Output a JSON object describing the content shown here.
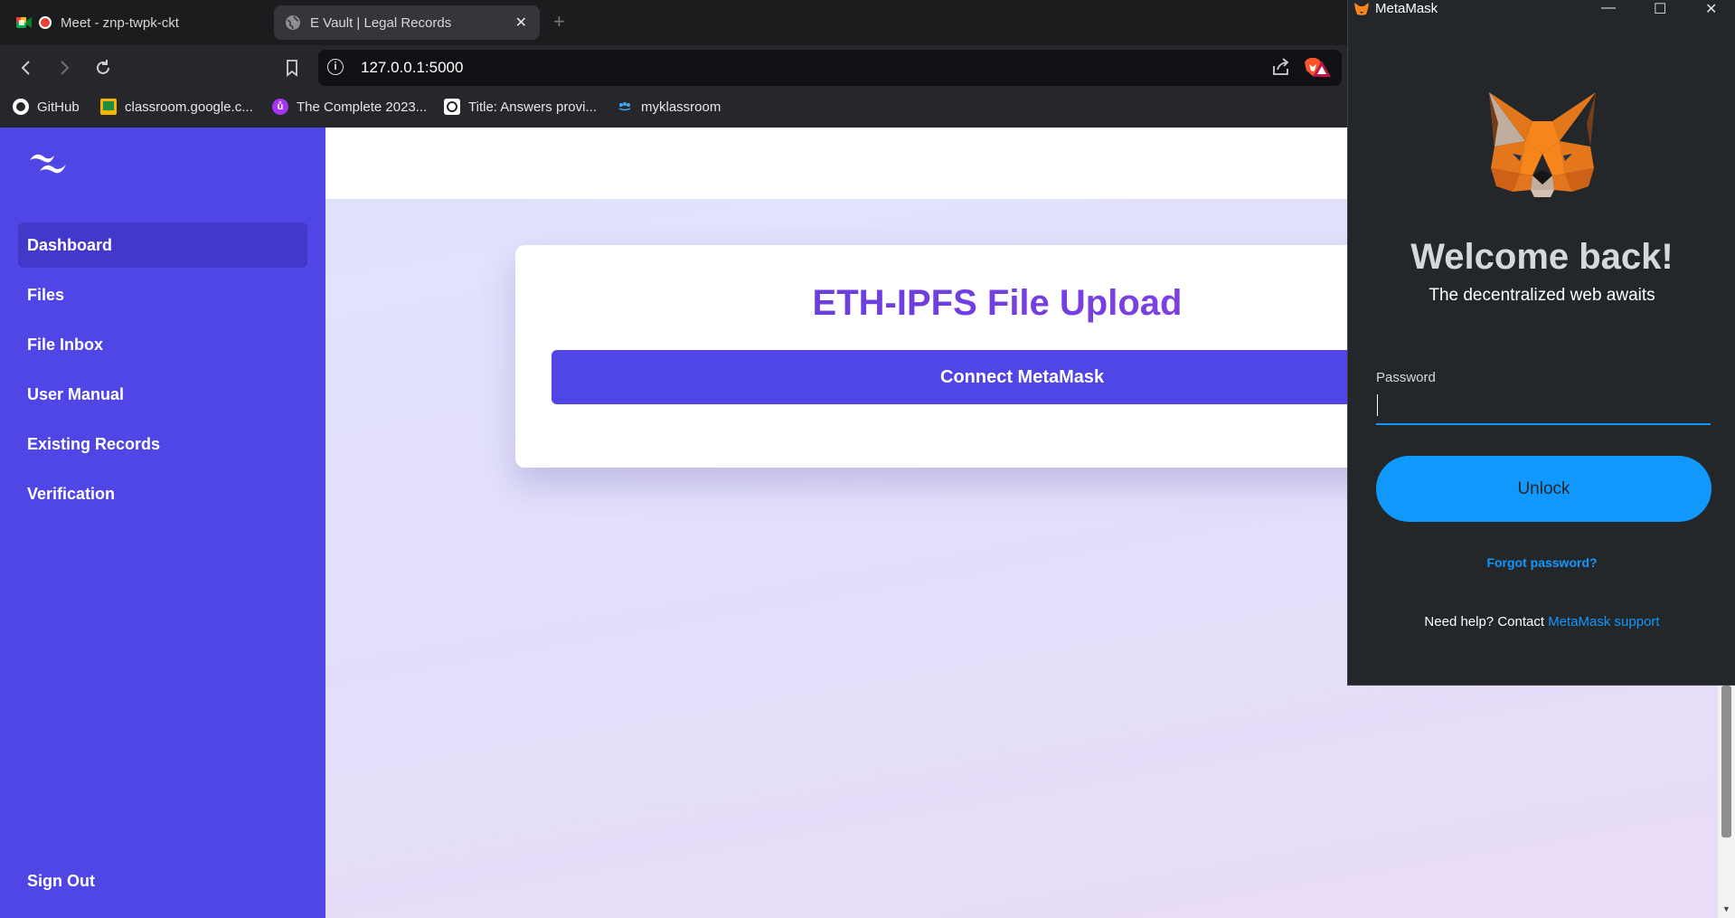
{
  "browser": {
    "tabs": [
      {
        "label": "Meet - znp-twpk-ckt"
      },
      {
        "label": "E Vault | Legal Records"
      }
    ],
    "url": "127.0.0.1:5000",
    "bookmarks": [
      {
        "label": "GitHub",
        "icon": "github-icon"
      },
      {
        "label": "classroom.google.c...",
        "icon": "classroom-icon"
      },
      {
        "label": "The Complete 2023...",
        "icon": "udemy-icon"
      },
      {
        "label": "Title: Answers provi...",
        "icon": "chatgpt-icon"
      },
      {
        "label": "myklassroom",
        "icon": "myklassroom-icon"
      }
    ]
  },
  "sidebar": {
    "items": [
      {
        "label": "Dashboard",
        "active": true
      },
      {
        "label": "Files"
      },
      {
        "label": "File Inbox"
      },
      {
        "label": "User Manual"
      },
      {
        "label": "Existing Records"
      },
      {
        "label": "Verification"
      }
    ],
    "sign_out": "Sign Out"
  },
  "main": {
    "title": "ETH-IPFS File Upload",
    "connect_button": "Connect MetaMask"
  },
  "metamask": {
    "window_title": "MetaMask",
    "welcome": "Welcome back!",
    "subtitle": "The decentralized web awaits",
    "password_label": "Password",
    "password_value": "",
    "unlock_button": "Unlock",
    "forgot_password": "Forgot password?",
    "help_text": "Need help? Contact ",
    "help_link": "MetaMask support"
  },
  "colors": {
    "sidebar": "#4f46e5",
    "sidebar_active": "#4338ca",
    "title_gradient_start": "#5b3fd9",
    "title_gradient_end": "#8b3fe6",
    "metamask_blue": "#1098fc",
    "metamask_bg": "#24272a"
  }
}
